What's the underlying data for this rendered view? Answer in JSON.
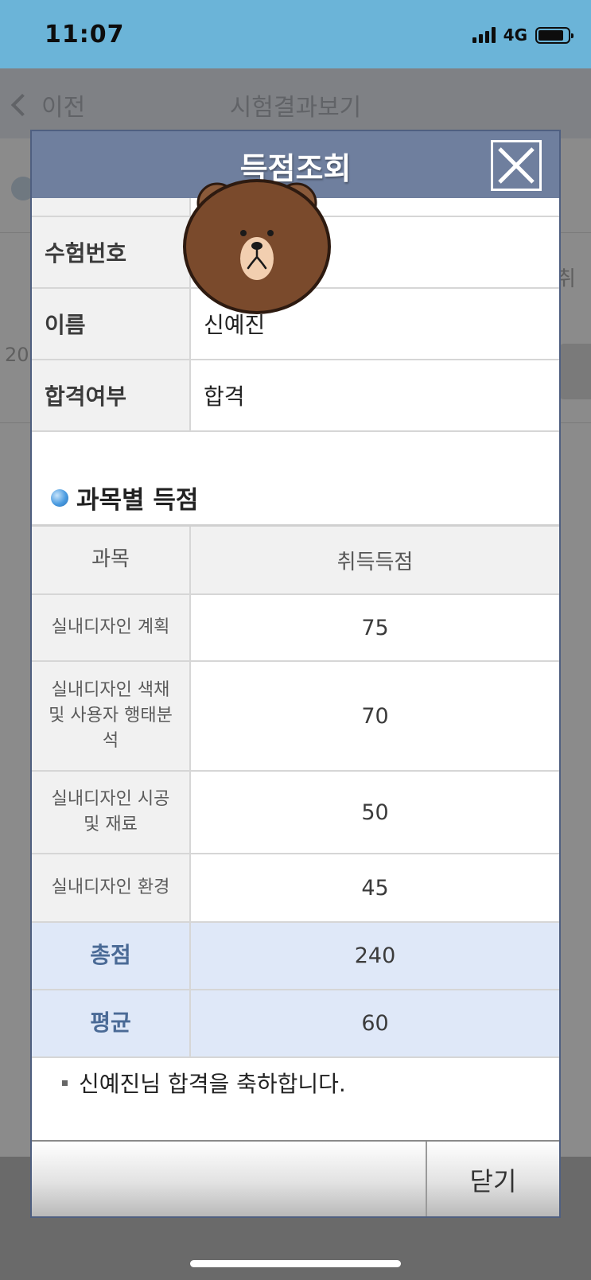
{
  "status_bar": {
    "time": "11:07",
    "network": "4G",
    "icons": [
      "cellular-signal-icon",
      "battery-icon"
    ]
  },
  "background_page": {
    "back_label": "이전",
    "title": "시험결과보기",
    "fragment_left": "20",
    "fragment_right": "취"
  },
  "modal": {
    "title": "득점조회",
    "close_icon": "close-icon",
    "info": [
      {
        "label": "수험번호",
        "value": ""
      },
      {
        "label": "이름",
        "value": "신예진"
      },
      {
        "label": "합격여부",
        "value": "합격"
      }
    ],
    "section_title": "과목별 득점",
    "table": {
      "headers": [
        "과목",
        "취득득점"
      ],
      "rows": [
        {
          "subject": "실내디자인 계획",
          "score": "75"
        },
        {
          "subject": "실내디자인 색채\n및 사용자 행태분\n석",
          "score": "70"
        },
        {
          "subject": "실내디자인 시공\n및 재료",
          "score": "50"
        },
        {
          "subject": "실내디자인 환경",
          "score": "45"
        }
      ],
      "total": {
        "label": "총점",
        "value": "240"
      },
      "average": {
        "label": "평균",
        "value": "60"
      }
    },
    "message": "신예진님 합격을 축하합니다.",
    "close_button_label": "닫기"
  },
  "sticker": "bear-sticker"
}
